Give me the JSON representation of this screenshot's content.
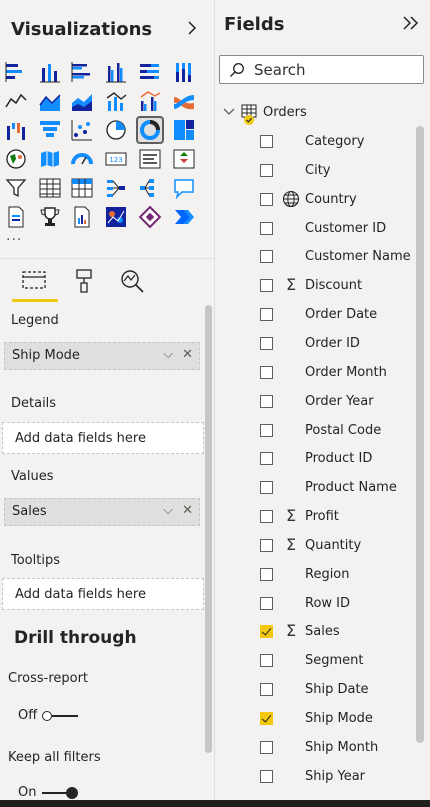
{
  "viz": {
    "title": "Visualizations",
    "expand_icon": "chevron-right-icon",
    "icons": [
      "stacked-bar-chart-icon",
      "stacked-column-chart-icon",
      "clustered-bar-chart-icon",
      "clustered-column-chart-icon",
      "100-stacked-bar-chart-icon",
      "100-stacked-column-chart-icon",
      "line-chart-icon",
      "area-chart-icon",
      "stacked-area-chart-icon",
      "line-and-column-chart-icon",
      "line-and-clustered-column-chart-icon",
      "ribbon-chart-icon",
      "waterfall-chart-icon",
      "funnel-chart-icon",
      "scatter-chart-icon",
      "pie-chart-icon",
      "donut-chart-icon",
      "treemap-icon",
      "map-icon",
      "filled-map-icon",
      "gauge-icon",
      "card-icon",
      "multi-row-card-icon",
      "kpi-icon",
      "slicer-icon",
      "table-icon",
      "matrix-icon",
      "key-influencers-icon",
      "decomposition-tree-icon",
      "qa-icon",
      "paginated-report-icon",
      "trophy-icon",
      "smart-narrative-icon",
      "python-visual-icon",
      "power-apps-icon",
      "power-automate-icon"
    ],
    "selected_icon": "donut-chart-icon",
    "more": "···",
    "tabs": [
      "fields-tab-icon",
      "format-paint-icon",
      "analytics-icon"
    ],
    "legend_label": "Legend",
    "legend_value": "Ship Mode",
    "details_label": "Details",
    "details_placeholder": "Add data fields here",
    "values_label": "Values",
    "values_value": "Sales",
    "tooltips_label": "Tooltips",
    "tooltips_placeholder": "Add data fields here",
    "drill_title": "Drill through",
    "cross_report_label": "Cross-report",
    "cross_report_state": "Off",
    "keep_filters_label": "Keep all filters",
    "keep_filters_state": "On",
    "chevron_down": "⌵",
    "remove": "✕"
  },
  "fields": {
    "title": "Fields",
    "collapse_icon": "double-chevron-right-icon",
    "search_placeholder": "Search",
    "table_name": "Orders",
    "items": [
      {
        "name": "Category",
        "type": "",
        "checked": false
      },
      {
        "name": "City",
        "type": "",
        "checked": false
      },
      {
        "name": "Country",
        "type": "globe",
        "checked": false
      },
      {
        "name": "Customer ID",
        "type": "",
        "checked": false
      },
      {
        "name": "Customer Name",
        "type": "",
        "checked": false
      },
      {
        "name": "Discount",
        "type": "sigma",
        "checked": false
      },
      {
        "name": "Order Date",
        "type": "",
        "checked": false
      },
      {
        "name": "Order ID",
        "type": "",
        "checked": false
      },
      {
        "name": "Order Month",
        "type": "",
        "checked": false
      },
      {
        "name": "Order Year",
        "type": "",
        "checked": false
      },
      {
        "name": "Postal Code",
        "type": "",
        "checked": false
      },
      {
        "name": "Product ID",
        "type": "",
        "checked": false
      },
      {
        "name": "Product Name",
        "type": "",
        "checked": false
      },
      {
        "name": "Profit",
        "type": "sigma",
        "checked": false
      },
      {
        "name": "Quantity",
        "type": "sigma",
        "checked": false
      },
      {
        "name": "Region",
        "type": "",
        "checked": false
      },
      {
        "name": "Row ID",
        "type": "",
        "checked": false
      },
      {
        "name": "Sales",
        "type": "sigma",
        "checked": true
      },
      {
        "name": "Segment",
        "type": "",
        "checked": false
      },
      {
        "name": "Ship Date",
        "type": "",
        "checked": false
      },
      {
        "name": "Ship Mode",
        "type": "",
        "checked": true
      },
      {
        "name": "Ship Month",
        "type": "",
        "checked": false
      },
      {
        "name": "Ship Year",
        "type": "",
        "checked": false
      }
    ]
  },
  "colors": {
    "accent_yellow": "#f2c811",
    "chart_blue": "#118dff",
    "chart_navy": "#12239e",
    "chart_orange": "#e66c37"
  }
}
